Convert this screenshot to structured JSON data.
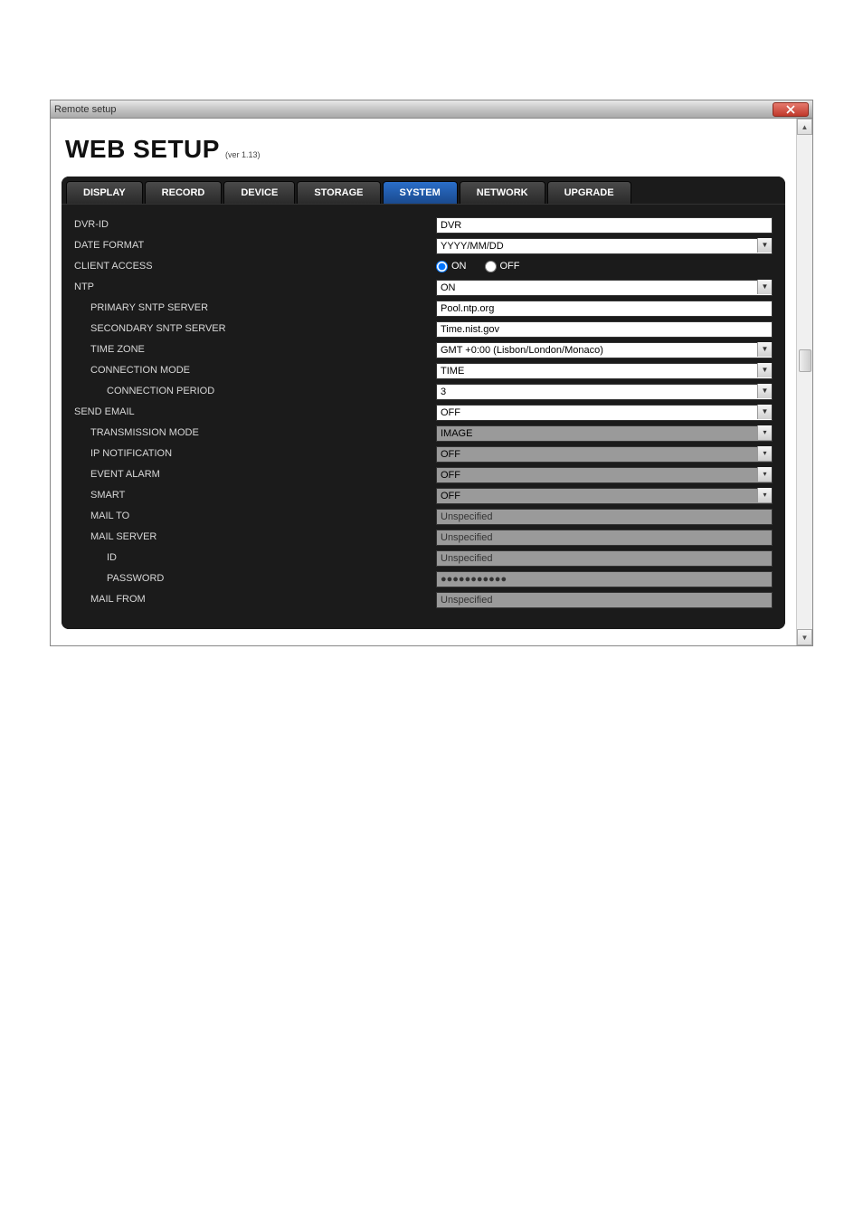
{
  "window": {
    "title": "Remote setup"
  },
  "header": {
    "title": "WEB SETUP",
    "version": "(ver 1.13)"
  },
  "tabs": {
    "display": "DISPLAY",
    "record": "RECORD",
    "device": "DEVICE",
    "storage": "STORAGE",
    "system": "SYSTEM",
    "network": "NETWORK",
    "upgrade": "UPGRADE"
  },
  "labels": {
    "dvr_id": "DVR-ID",
    "date_format": "DATE FORMAT",
    "client_access": "CLIENT ACCESS",
    "ntp": "NTP",
    "primary_sntp": "PRIMARY SNTP SERVER",
    "secondary_sntp": "SECONDARY SNTP SERVER",
    "time_zone": "TIME ZONE",
    "connection_mode": "CONNECTION MODE",
    "connection_period": "CONNECTION PERIOD",
    "send_email": "SEND EMAIL",
    "transmission_mode": "TRANSMISSION MODE",
    "ip_notification": "IP NOTIFICATION",
    "event_alarm": "EVENT ALARM",
    "smart": "SMART",
    "mail_to": "MAIL TO",
    "mail_server": "MAIL SERVER",
    "id": "ID",
    "password": "PASSWORD",
    "mail_from": "MAIL FROM"
  },
  "values": {
    "dvr_id": "DVR",
    "date_format": "YYYY/MM/DD",
    "client_access_on": "ON",
    "client_access_off": "OFF",
    "ntp": "ON",
    "primary_sntp": "Pool.ntp.org",
    "secondary_sntp": "Time.nist.gov",
    "time_zone": "GMT +0:00 (Lisbon/London/Monaco)",
    "connection_mode": "TIME",
    "connection_period": "3",
    "send_email": "OFF",
    "transmission_mode": "IMAGE",
    "ip_notification": "OFF",
    "event_alarm": "OFF",
    "smart": "OFF",
    "mail_to": "Unspecified",
    "mail_server": "Unspecified",
    "id": "Unspecified",
    "password": "●●●●●●●●●●●",
    "mail_from": "Unspecified"
  }
}
